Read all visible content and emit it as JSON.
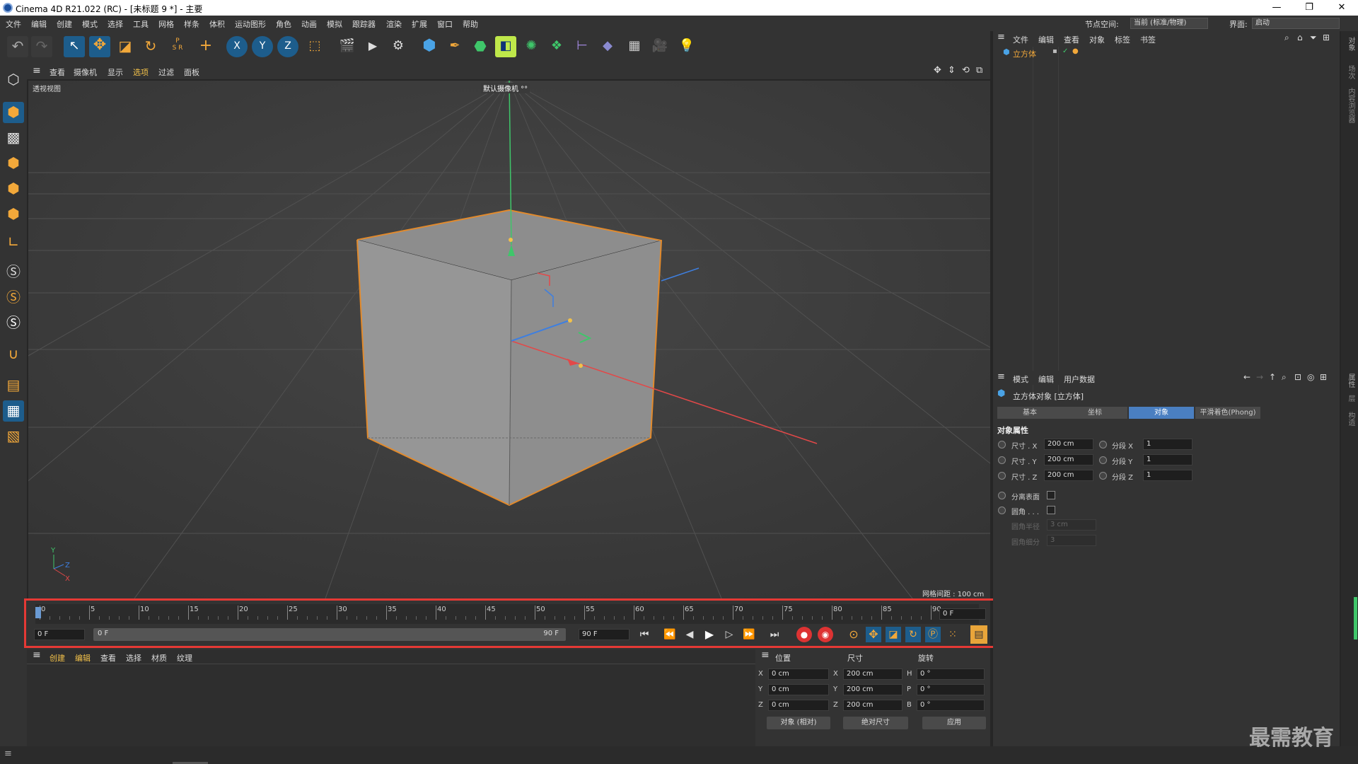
{
  "window": {
    "title": "Cinema 4D R21.022 (RC) - [未标题 9 *] - 主要",
    "minimize": "—",
    "restore": "❐",
    "close": "✕"
  },
  "menubar": {
    "items": [
      "文件",
      "编辑",
      "创建",
      "模式",
      "选择",
      "工具",
      "网格",
      "样条",
      "体积",
      "运动图形",
      "角色",
      "动画",
      "模拟",
      "跟踪器",
      "渲染",
      "扩展",
      "窗口",
      "帮助"
    ],
    "node_space_label": "节点空间:",
    "node_space_value": "当前 (标准/物理)",
    "layout_label": "界面:",
    "layout_value": "启动"
  },
  "toolbar": {
    "icons": [
      "undo-icon",
      "redo-icon",
      "select-arrow-icon",
      "move-icon",
      "scale-icon",
      "rotate-icon",
      "psr-icon",
      "add-icon",
      "x-axis-icon",
      "y-axis-icon",
      "z-axis-icon",
      "coord-system-icon",
      "render-view-icon",
      "render-picture-viewer-icon",
      "render-settings-icon",
      "cube-object-icon",
      "pen-spline-icon",
      "subdivision-icon",
      "extrude-generator-icon",
      "cloner-icon",
      "array-icon",
      "deformer-icon",
      "floor-icon",
      "camera-icon",
      "light-icon"
    ]
  },
  "viewport": {
    "menu": [
      "查看",
      "摄像机",
      "显示",
      "选项",
      "过滤",
      "面板"
    ],
    "label": "透视视图",
    "camera": "默认摄像机 °°",
    "grid_spacing": "网格间距 : 100 cm"
  },
  "timeline": {
    "ticks": [
      "0",
      "5",
      "10",
      "15",
      "20",
      "25",
      "30",
      "35",
      "40",
      "45",
      "50",
      "55",
      "60",
      "65",
      "70",
      "75",
      "80",
      "85",
      "90"
    ],
    "current_frame": "0 F",
    "start_field": "0 F",
    "slider_start": "0 F",
    "slider_end": "90 F",
    "end_field": "90 F"
  },
  "material": {
    "menu": [
      "创建",
      "编辑",
      "查看",
      "选择",
      "材质",
      "纹理"
    ]
  },
  "coords": {
    "headers": [
      "位置",
      "尺寸",
      "旋转"
    ],
    "rows": [
      {
        "axis": "X",
        "pos": "0 cm",
        "saxis": "X",
        "size": "200 cm",
        "raxis": "H",
        "rot": "0 °"
      },
      {
        "axis": "Y",
        "pos": "0 cm",
        "saxis": "Y",
        "size": "200 cm",
        "raxis": "P",
        "rot": "0 °"
      },
      {
        "axis": "Z",
        "pos": "0 cm",
        "saxis": "Z",
        "size": "200 cm",
        "raxis": "B",
        "rot": "0 °"
      }
    ],
    "mode": "对象 (相对)",
    "size_mode": "绝对尺寸",
    "apply": "应用"
  },
  "objects": {
    "menu": [
      "文件",
      "编辑",
      "查看",
      "对象",
      "标签",
      "书签"
    ],
    "items": [
      "立方体"
    ]
  },
  "attributes": {
    "menu": [
      "模式",
      "编辑",
      "用户数据"
    ],
    "title": "立方体对象 [立方体]",
    "tabs": [
      "基本",
      "坐标",
      "对象",
      "平滑着色(Phong)"
    ],
    "active_tab": "对象",
    "section": "对象属性",
    "rows": [
      {
        "label": "尺寸 . X",
        "value": "200 cm",
        "seg_label": "分段 X",
        "seg": "1"
      },
      {
        "label": "尺寸 . Y",
        "value": "200 cm",
        "seg_label": "分段 Y",
        "seg": "1"
      },
      {
        "label": "尺寸 . Z",
        "value": "200 cm",
        "seg_label": "分段 Z",
        "seg": "1"
      }
    ],
    "separate_surfaces": "分离表面",
    "fillet": "圆角 . . .",
    "fillet_radius": "圆角半径",
    "fillet_radius_value": "3 cm",
    "fillet_subdiv": "圆角细分",
    "fillet_subdiv_value": "3"
  },
  "right_strip": [
    "对象",
    "场次",
    "内容浏览器",
    "属性",
    "层",
    "构造"
  ],
  "watermark": "最需教育"
}
